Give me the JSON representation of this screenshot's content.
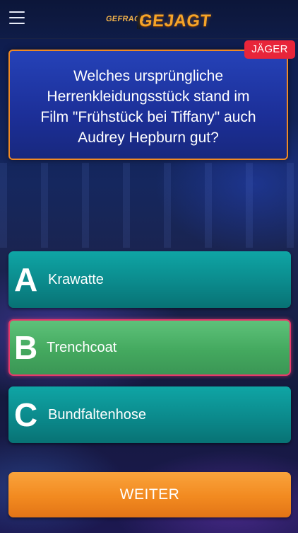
{
  "header": {
    "logo_small": "GEFRAGT",
    "logo_big": "GEJAGT"
  },
  "question": {
    "badge": "JÄGER",
    "text": "Welches ursprüngliche Herrenkleidungsstück stand im Film \"Frühstück bei Tiffany\" auch Audrey Hepburn gut?"
  },
  "answers": [
    {
      "letter": "A",
      "text": "Krawatte",
      "state": "default"
    },
    {
      "letter": "B",
      "text": "Trenchcoat",
      "state": "correct"
    },
    {
      "letter": "C",
      "text": "Bundfaltenhose",
      "state": "default"
    }
  ],
  "weiter_label": "WEITER",
  "colors": {
    "answer_default": "#0b8a8c",
    "answer_correct": "#44a95f",
    "answer_correct_border": "#e63a6a",
    "question_bg": "#1c2f98",
    "question_border": "#f08a24",
    "badge": "#e8253a",
    "weiter": "#f28a20"
  }
}
